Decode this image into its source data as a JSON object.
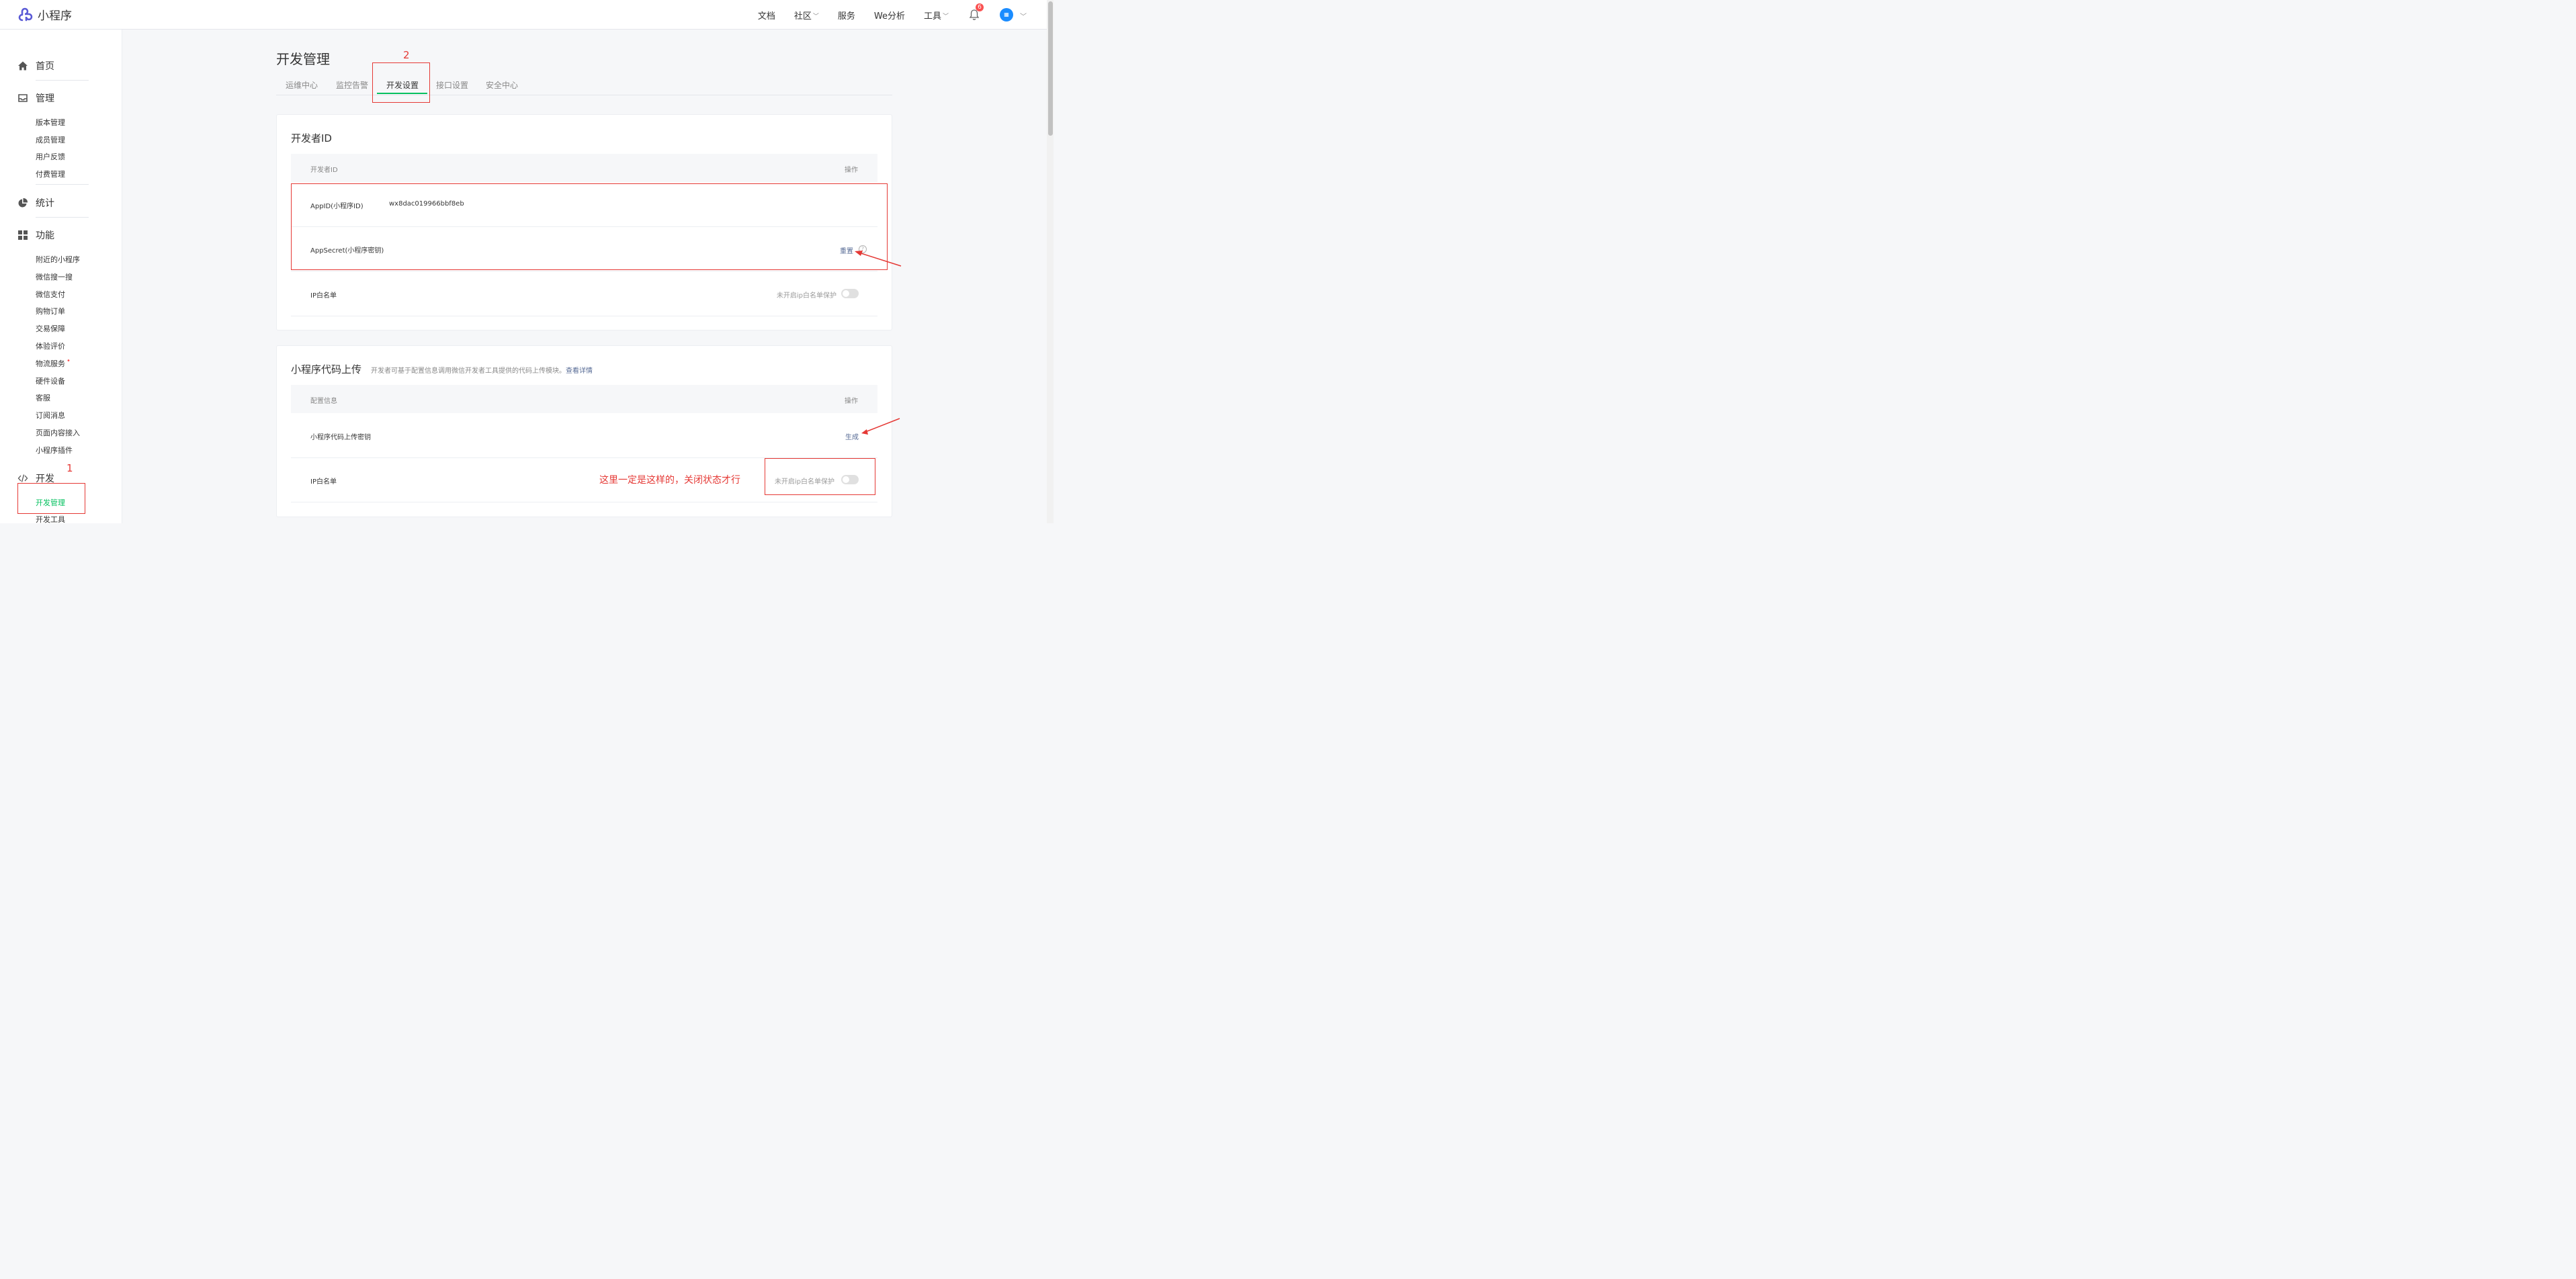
{
  "header": {
    "app_name": "小程序",
    "nav": [
      {
        "label": "文档"
      },
      {
        "label": "社区",
        "has_dropdown": true
      },
      {
        "label": "服务"
      },
      {
        "label": "We分析"
      },
      {
        "label": "工具",
        "has_dropdown": true
      }
    ],
    "notification_count": "6"
  },
  "sidebar": {
    "home": "首页",
    "manage": {
      "title": "管理",
      "items": [
        "版本管理",
        "成员管理",
        "用户反馈",
        "付费管理"
      ]
    },
    "stats": "统计",
    "features": {
      "title": "功能",
      "items": [
        "附近的小程序",
        "微信搜一搜",
        "微信支付",
        "购物订单",
        "交易保障",
        "体验评价",
        "物流服务",
        "硬件设备",
        "客服",
        "订阅消息",
        "页面内容接入",
        "小程序插件"
      ]
    },
    "dev": {
      "title": "开发",
      "items": [
        "开发管理",
        "开发工具"
      ],
      "active": "开发管理"
    }
  },
  "main": {
    "title": "开发管理",
    "tabs": [
      "运维中心",
      "监控告警",
      "开发设置",
      "接口设置",
      "安全中心"
    ],
    "active_tab": "开发设置",
    "developer_id": {
      "title": "开发者ID",
      "col_left": "开发者ID",
      "col_right": "操作",
      "appid_label": "AppID(小程序ID)",
      "appid_value": "wx8dac019966bbf8eb",
      "secret_label": "AppSecret(小程序密钥)",
      "secret_action": "重置",
      "ip_label": "IP白名单",
      "ip_status": "未开启ip白名单保护"
    },
    "code_upload": {
      "title": "小程序代码上传",
      "desc": "开发者可基于配置信息调用微信开发者工具提供的代码上传模块。",
      "desc_link": "查看详情",
      "col_left": "配置信息",
      "col_right": "操作",
      "key_label": "小程序代码上传密钥",
      "key_action": "生成",
      "ip_label": "IP白名单",
      "ip_status": "未开启ip白名单保护"
    }
  },
  "annotations": {
    "step1": "1",
    "step2": "2",
    "note": "这里一定是这样的，关闭状态才行",
    "color": "#e53935"
  }
}
